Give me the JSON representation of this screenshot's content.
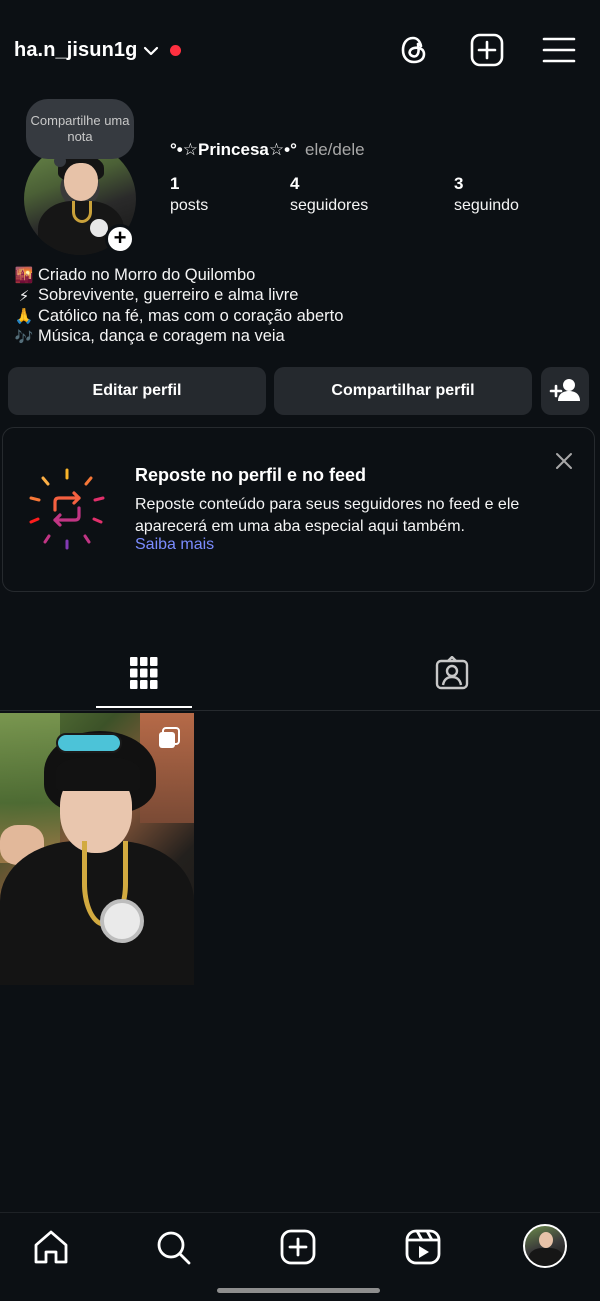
{
  "header": {
    "username": "ha.n_jisun1g",
    "icons": [
      "threads-icon",
      "create-icon",
      "menu-icon"
    ]
  },
  "profile": {
    "note": "Compartilhe uma nota",
    "display_name": "°•☆Princesa☆•°",
    "pronouns": "ele/dele",
    "stats": [
      {
        "value": "1",
        "label": "posts"
      },
      {
        "value": "4",
        "label": "seguidores"
      },
      {
        "value": "3",
        "label": "seguindo"
      }
    ],
    "bio": [
      {
        "emoji": "🌇",
        "text": "Criado no Morro do Quilombo"
      },
      {
        "emoji": "⚡",
        "text": "Sobrevivente, guerreiro e alma livre"
      },
      {
        "emoji": "🙏",
        "text": "Católico na fé, mas com o coração aberto"
      },
      {
        "emoji": "🎶",
        "text": "Música, dança e coragem na veia"
      }
    ]
  },
  "actions": {
    "edit_label": "Editar perfil",
    "share_label": "Compartilhar perfil"
  },
  "repost_card": {
    "title": "Reposte no perfil e no feed",
    "body": "Reposte conteúdo para seus seguidores no feed e ele aparecerá em uma aba especial aqui também.",
    "link": "Saiba mais"
  },
  "tabs": [
    "grid",
    "tagged"
  ],
  "colors": {
    "background": "#0c1014",
    "button": "#25292e",
    "link": "#7b8cff",
    "notification_dot": "#ff3040"
  }
}
